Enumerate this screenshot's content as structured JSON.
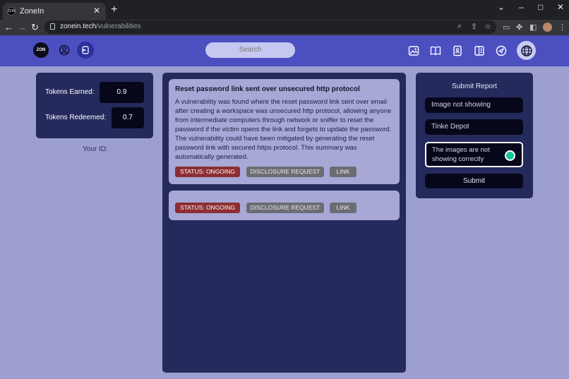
{
  "browser": {
    "tab_title": "ZoneIn",
    "favicon_text": "ZON",
    "url_domain": "zonein.tech",
    "url_path": "/vulnerabilities"
  },
  "header": {
    "logo_text": "ZON",
    "search_placeholder": "Search"
  },
  "tokens": {
    "earned_label": "Tokens Earned:",
    "earned_value": "0.9",
    "redeemed_label": "Tokens Redeemed:",
    "redeemed_value": "0.7",
    "your_id_label": "Your ID:"
  },
  "reports": [
    {
      "title": "Reset password link sent over unsecured http protocol",
      "summary": "A vulnerability was found where the reset password link sent over email after creating a workspace was unsecured http protocol, allowing anyone from intermediate computers through network or sniffer to reset the password if the victim opens the link and forgets to update the password. The vulnerability could have been mitigated by generating the reset password link with secured https protocol. This summary was automatically generated.",
      "status": "STATUS: ONGOING",
      "disclosure": "DISCLOSURE REQUEST",
      "link": "LINK"
    },
    {
      "title": "",
      "summary": "",
      "status": "STATUS: ONGOING",
      "disclosure": "DISCLOSURE REQUEST",
      "link": "LINK"
    }
  ],
  "submit": {
    "title": "Submit Report",
    "field1_value": "Image not showing",
    "field2_value": "Tinke Depot",
    "description_value": "The images are not showing correctly",
    "button_label": "Submit"
  },
  "colors": {
    "background": "#9c9fcf",
    "header": "#4b4fc0",
    "panel": "#252a5c",
    "status_chip": "#8c2e32"
  }
}
